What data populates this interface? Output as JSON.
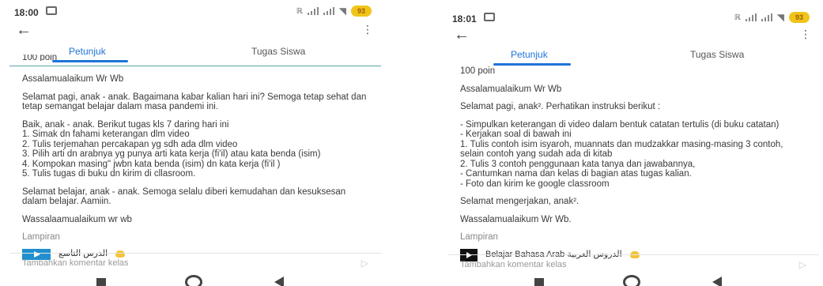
{
  "left": {
    "status_time": "18:00",
    "battery": "93",
    "tabs": [
      "Petunjuk",
      "Tugas Siswa"
    ],
    "points": "100 poin",
    "paragraphs": [
      "Assalamualaikum Wr Wb",
      "Selamat pagi, anak - anak. Bagaimana kabar kalian hari ini? Semoga tetap sehat dan tetap semangat belajar dalam masa pandemi ini.",
      "Baik, anak - anak. Berikut tugas kls  7 daring hari ini\n1. Simak dn fahami keterangan dlm video\n2. Tulis terjemahan percakapan yg sdh ada dlm video\n3. Pilih arti dn arabnya yg punya arti kata kerja (fi'il) atau kata benda (isim)\n4. Kompokan masing\" jwbn kata benda (isim) dn kata kerja (fi'il )\n5. Tulis tugas di buku dn kirim di cllasroom.",
      "Selamat belajar, anak - anak. Semoga selalu diberi kemudahan dan kesuksesan dalam belajar. Aamiin.",
      "Wassalaamualaikum wr wb"
    ],
    "lampiran": "Lampiran",
    "attachment_title": "الدرس التاسع",
    "comment_placeholder": "Tambahkan komentar kelas"
  },
  "right": {
    "status_time": "18:01",
    "battery": "93",
    "tabs": [
      "Petunjuk",
      "Tugas Siswa"
    ],
    "points": "100 poin",
    "paragraphs": [
      "Assalamualaikum Wr Wb",
      "Selamat pagi, anak². Perhatikan instruksi berikut :",
      "- Simpulkan keterangan di video dalam bentuk catatan tertulis (di buku catatan)\n- Kerjakan soal di bawah ini\n1. Tulis contoh isim isyaroh, muannats dan mudzakkar masing-masing 3 contoh, selain contoh yang sudah ada di kitab\n2. Tulis 3 contoh penggunaan kata tanya dan jawabannya,\n- Cantumkan nama dan kelas di bagian atas tugas kalian.\n- Foto dan kirim ke google classroom",
      "Selamat mengerjakan, anak².",
      "Wassalamualaikum Wr Wb."
    ],
    "lampiran": "Lampiran",
    "attachment_title": "Belajar Bahasa Arab الدروس العربية",
    "comment_placeholder": "Tambahkan komentar kelas"
  },
  "icons": {
    "back": "back-arrow-icon",
    "more": "more-vert-icon",
    "send": "send-icon",
    "nav_recent": "recent-apps-icon",
    "nav_home": "home-icon",
    "nav_back": "nav-back-icon"
  }
}
